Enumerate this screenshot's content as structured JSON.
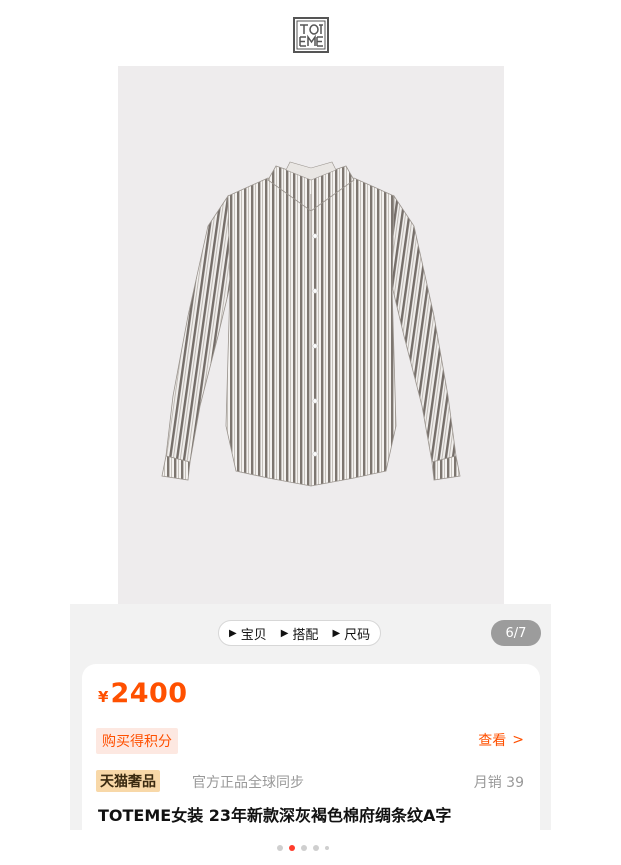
{
  "brand": {
    "logo_icon": "toteme-logo-icon"
  },
  "product_image": {
    "alt_icon": "striped-shirt-image"
  },
  "tabs": [
    {
      "label": "宝贝",
      "icon": "play-triangle-icon"
    },
    {
      "label": "搭配",
      "icon": "play-triangle-icon"
    },
    {
      "label": "尺码",
      "icon": "play-triangle-icon"
    }
  ],
  "gallery": {
    "counter": "6/7",
    "total_dots": 5,
    "active_dot": 1
  },
  "price": {
    "currency": "¥",
    "amount": "2400"
  },
  "points": {
    "label": "购买得积分",
    "view_label": "查看",
    "view_icon": "chevron-right-icon"
  },
  "store": {
    "badge": "天猫奢品",
    "official": "官方正品全球同步",
    "monthly_sales": "月销 39"
  },
  "product": {
    "title": "TOTEME女装 23年新款深灰褐色棉府绸条纹A字"
  },
  "colors": {
    "accent": "#ff5000",
    "badge_bg": "#f8d8a8",
    "points_bg": "#fde8e1",
    "counter_bg": "#9c9c9c"
  }
}
